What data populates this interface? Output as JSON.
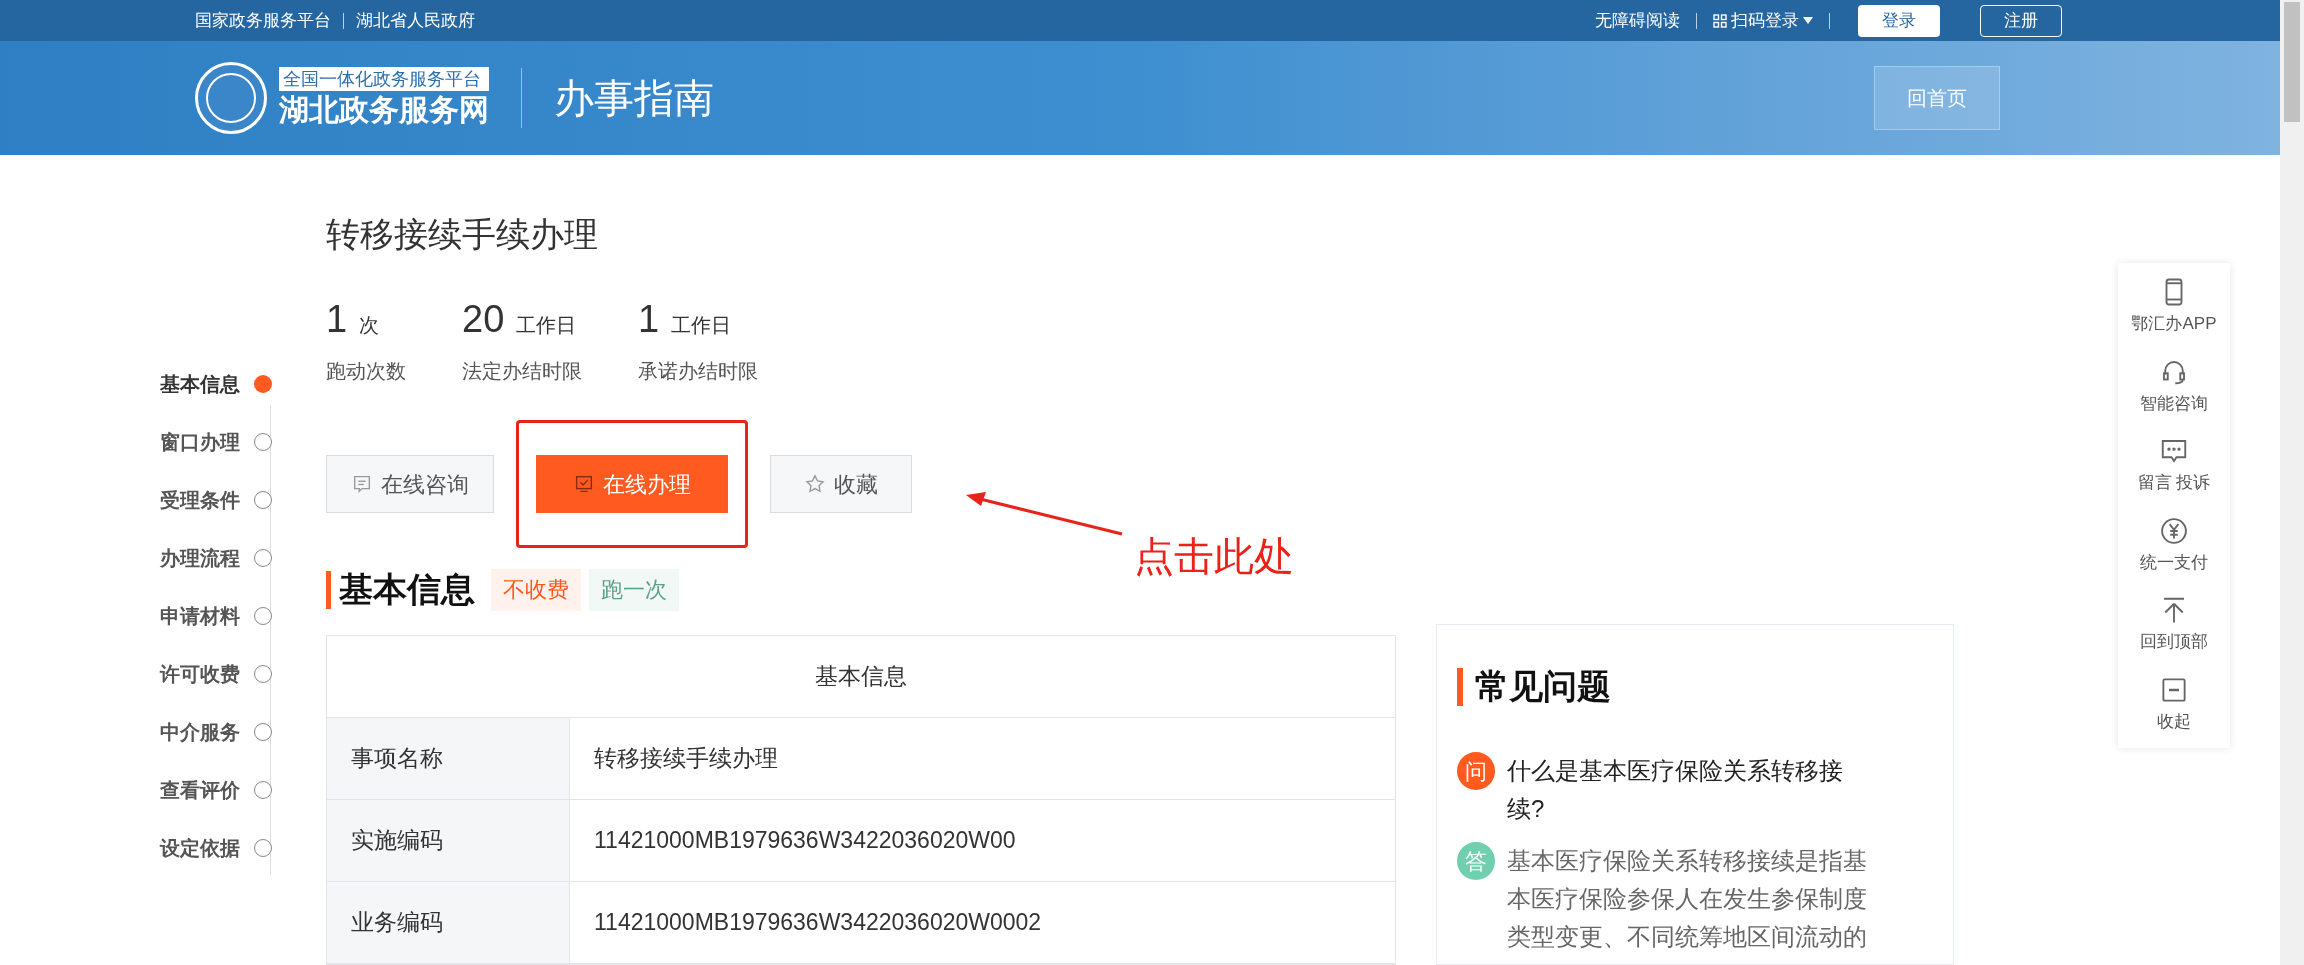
{
  "top_bar": {
    "left_links": [
      "国家政务服务平台",
      "湖北省人民政府"
    ],
    "accessibility": "无障碍阅读",
    "scan_login": "扫码登录",
    "login": "登录",
    "register": "注册"
  },
  "header": {
    "logo_badge": "全国一体化政务服务平台",
    "logo_name": "湖北政务服务网",
    "page_title": "办事指南",
    "home_button": "回首页"
  },
  "service_title": "转移接续手续办理",
  "stats": [
    {
      "value": "1",
      "unit": "次",
      "label": "跑动次数"
    },
    {
      "value": "20",
      "unit": "工作日",
      "label": "法定办结时限"
    },
    {
      "value": "1",
      "unit": "工作日",
      "label": "承诺办结时限"
    }
  ],
  "side_nav": [
    {
      "label": "基本信息",
      "selected": true
    },
    {
      "label": "窗口办理",
      "selected": false
    },
    {
      "label": "受理条件",
      "selected": false
    },
    {
      "label": "办理流程",
      "selected": false
    },
    {
      "label": "申请材料",
      "selected": false
    },
    {
      "label": "许可收费",
      "selected": false
    },
    {
      "label": "中介服务",
      "selected": false
    },
    {
      "label": "查看评价",
      "selected": false
    },
    {
      "label": "设定依据",
      "selected": false
    }
  ],
  "actions": [
    {
      "kind": "consult",
      "label": "在线咨询",
      "primary": false
    },
    {
      "kind": "handle",
      "label": "在线办理",
      "primary": true
    },
    {
      "kind": "favorite",
      "label": "收藏",
      "primary": false
    }
  ],
  "annotation": "点击此处",
  "section": {
    "title": "基本信息",
    "tags": [
      {
        "label": "不收费",
        "color": "#ff5a1f"
      },
      {
        "label": "跑一次",
        "color": "#5aa08a"
      }
    ]
  },
  "table": {
    "title": "基本信息",
    "rows": [
      [
        "事项名称",
        "转移接续手续办理"
      ],
      [
        "实施编码",
        "11421000MB1979636W3422036020W00"
      ],
      [
        "业务编码",
        "11421000MB1979636W3422036020W0002"
      ]
    ]
  },
  "faq": {
    "title": "常见问题",
    "question_mark": "问",
    "question": "什么是基本医疗保险关系转移接续?",
    "answer_mark": "答",
    "answer": "基本医疗保险关系转移接续是指基本医疗保险参保人在发生参保制度类型变更、不同统筹地区间流动的"
  },
  "float_bar": [
    {
      "kind": "phone",
      "label": "鄂汇办APP"
    },
    {
      "kind": "headset",
      "label": "智能咨询"
    },
    {
      "kind": "message",
      "label": "留言 投诉"
    },
    {
      "kind": "yen",
      "label": "统一支付"
    },
    {
      "kind": "top",
      "label": "回到顶部"
    },
    {
      "kind": "collapse",
      "label": "收起"
    }
  ]
}
